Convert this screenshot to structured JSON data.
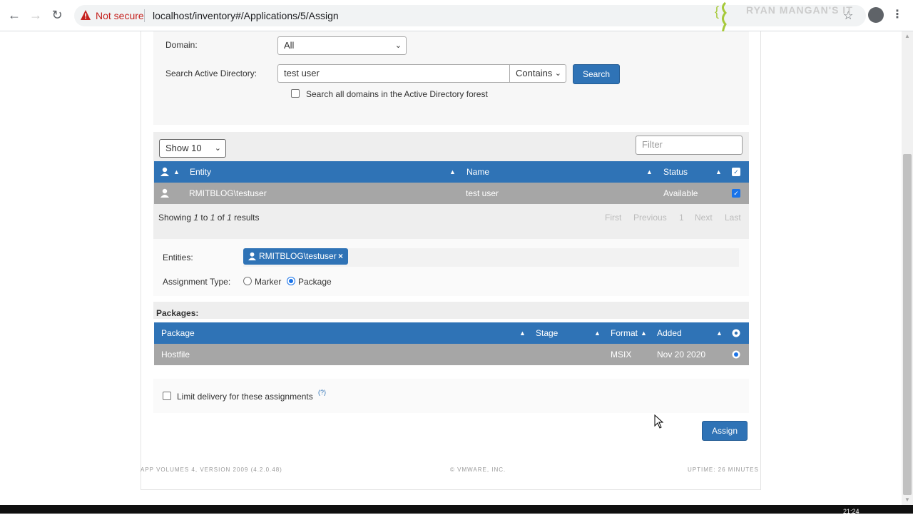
{
  "browser": {
    "security_label": "Not secure",
    "url": "localhost/inventory#/Applications/5/Assign",
    "watermark": "RYAN MANGAN'S IT"
  },
  "search": {
    "domain_label": "Domain:",
    "domain_value": "All",
    "ad_label": "Search Active Directory:",
    "ad_value": "test user",
    "match_value": "Contains",
    "search_button": "Search",
    "all_domains_label": "Search all domains in the Active Directory forest"
  },
  "results": {
    "page_size": "Show 10",
    "filter_placeholder": "Filter",
    "columns": [
      "Entity",
      "Name",
      "Status"
    ],
    "rows": [
      {
        "entity": "RMITBLOG\\testuser",
        "name": "test user",
        "status": "Available",
        "selected": true
      }
    ],
    "summary": {
      "prefix": "Showing ",
      "from": "1",
      "to_word": " to ",
      "to": "1",
      "of_word": " of ",
      "total": "1",
      "suffix": " results"
    },
    "pager": {
      "first": "First",
      "previous": "Previous",
      "page": "1",
      "next": "Next",
      "last": "Last"
    }
  },
  "assignment": {
    "entities_label": "Entities:",
    "entity_tag": "RMITBLOG\\testuser",
    "type_label": "Assignment Type:",
    "type_options": [
      "Marker",
      "Package"
    ],
    "selected_type": "Package"
  },
  "packages": {
    "heading": "Packages:",
    "columns": [
      "Package",
      "Stage",
      "Format",
      "Added"
    ],
    "rows": [
      {
        "package": "Hostfile",
        "stage": "",
        "format": "MSIX",
        "added": "Nov 20 2020",
        "selected": true
      }
    ]
  },
  "limit": {
    "label": "Limit delivery for these assignments",
    "help": "(?)"
  },
  "actions": {
    "assign_button": "Assign"
  },
  "footer": {
    "version": "APP VOLUMES 4, VERSION 2009 (4.2.0.48)",
    "copyright": "© VMWARE, INC.",
    "uptime": "UPTIME: 26 MINUTES"
  },
  "taskbar": {
    "clock": "21:24"
  },
  "colors": {
    "primary": "#2f73b6",
    "row_grey": "#a6a6a6",
    "warning": "#c5221f"
  }
}
